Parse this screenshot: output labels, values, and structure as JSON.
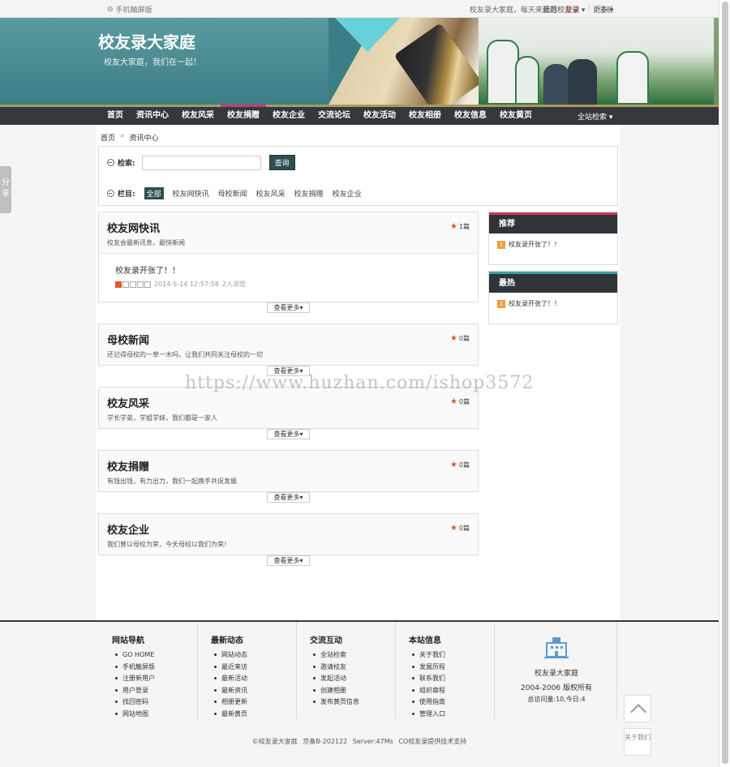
{
  "topbar": {
    "mobile": "手机触屏版",
    "greeting": "校友录大家庭，每天来逛逛",
    "login": "登录",
    "register": "注册",
    "my": "我的校友录",
    "more": "更多"
  },
  "banner": {
    "title": "校友录大家庭",
    "slogan": "校友大家庭，我们在一起！"
  },
  "nav": {
    "items": [
      "首页",
      "资讯中心",
      "校友风采",
      "校友捐赠",
      "校友企业",
      "交流论坛",
      "校友活动",
      "校友相册",
      "校友信息",
      "校友黄页"
    ],
    "search": "全站检索"
  },
  "breadcrumb": {
    "home": "首页",
    "current": "资讯中心"
  },
  "filter": {
    "search_label": "检索:",
    "search_button": "查询",
    "column_label": "栏目:",
    "categories": [
      "全部",
      "校友网快讯",
      "母校新闻",
      "校友风采",
      "校友捐赠",
      "校友企业"
    ]
  },
  "sections": [
    {
      "name": "校友网快讯",
      "desc": "校友会最新讯息，最快新闻",
      "count": "1篇",
      "post": "校友录开张了！！",
      "date": "2014-5-14 12:57:58",
      "views": "2人浏览",
      "rating": 1
    },
    {
      "name": "母校新闻",
      "desc": "还记得母校的一草一木吗，让我们共同关注母校的一切",
      "count": "0篇"
    },
    {
      "name": "校友风采",
      "desc": "学长学弟，学姐学妹，我们都是一家人",
      "count": "0篇"
    },
    {
      "name": "校友捐赠",
      "desc": "有钱出钱，有力出力，我们一起携手共促发展",
      "count": "0篇"
    },
    {
      "name": "校友企业",
      "desc": "我们曾以母校为荣，今天母校以我们为荣！",
      "count": "0篇"
    }
  ],
  "more_label": "查看更多",
  "sidebar": {
    "recommend_title": "推荐",
    "recommend_item": "校友录开张了！！",
    "hot_title": "最热",
    "hot_item": "校友录开张了！！",
    "rank": "1"
  },
  "share": "分享",
  "watermark": "https://www.huzhan.com/ishop3572",
  "footer": {
    "cols": [
      {
        "title": "网站导航",
        "items": [
          "GO HOME",
          "手机触屏版",
          "注册新用户",
          "用户登录",
          "找回密码",
          "网站地图"
        ]
      },
      {
        "title": "最新动态",
        "items": [
          "网站动态",
          "最近来访",
          "最新活动",
          "最新资讯",
          "相册更新",
          "最新黄页"
        ]
      },
      {
        "title": "交流互动",
        "items": [
          "全站检索",
          "邀请校友",
          "发起活动",
          "创建相册",
          "发布黄页信息"
        ]
      },
      {
        "title": "本站信息",
        "items": [
          "关于我们",
          "发展历程",
          "联系我们",
          "组织章程",
          "使用指南",
          "管理入口"
        ]
      }
    ],
    "site_name": "校友录大家庭",
    "copyright_years": "2004-2006 版权所有",
    "visits": "总访问量:10,今日:4",
    "bottom": "©校友录大家庭   京备B-202122   Server:47Ms CO校友录提供技术支持"
  },
  "about": "关于我们"
}
